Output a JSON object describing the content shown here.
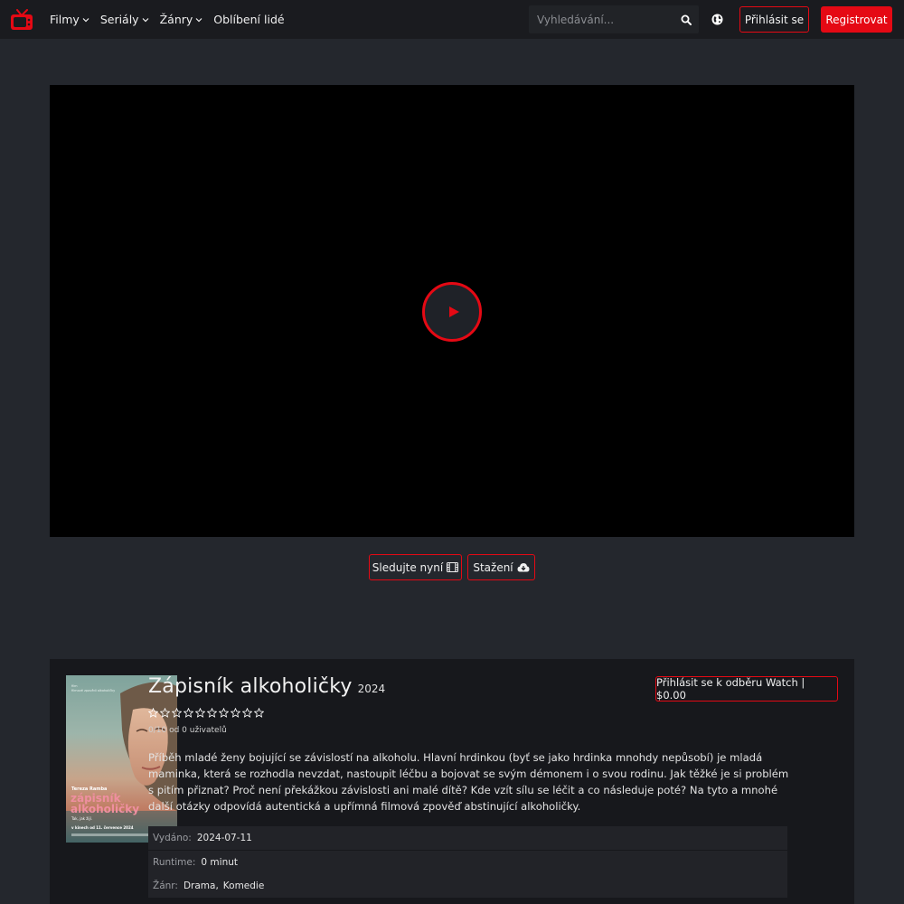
{
  "nav": {
    "menu": [
      {
        "label": "Filmy",
        "dropdown": true
      },
      {
        "label": "Seriály",
        "dropdown": true
      },
      {
        "label": "Žánry",
        "dropdown": true
      },
      {
        "label": "Oblíbení lidé",
        "dropdown": false
      }
    ],
    "search_placeholder": "Vyhledávání...",
    "login_label": "Přihlásit se",
    "register_label": "Registrovat",
    "accent_color": "#e50914"
  },
  "player": {
    "watch_label": "Sledujte nyní",
    "download_label": "Stažení"
  },
  "movie": {
    "title": "Zápisník alkoholičky",
    "year": "2024",
    "star_count": 10,
    "rating_value": 0,
    "rating_text": "0/10 od 0 uživatelů",
    "subscribe_label": "Přihlásit se k odběru Watch | $0.00",
    "description": "Příběh mladé ženy bojující se závislostí na alkoholu. Hlavní hrdinkou (byť se jako hrdinka mnohdy nepůsobí) je mladá maminka, která se rozhodla nevzdat, nastoupit léčbu a bojovat se svým démonem i o svou rodinu. Jak těžké je si problém s pitím přiznat? Proč není překážkou závislosti ani malé dítě? Kde vzít sílu se léčit a co následuje poté? Na tyto a mnohé další otázky odpovídá autentická a upřímná filmová zpověď abstinující alkoholičky.",
    "meta": {
      "released_label": "Vydáno:",
      "released_value": "2024-07-11",
      "runtime_label": "Runtime:",
      "runtime_value": "0 minut",
      "genre_label": "Žánr:",
      "genres": [
        "Drama,",
        "Komedie"
      ]
    },
    "poster": {
      "actress": "Tereza Ramba",
      "title_line1": "zápisník",
      "title_line2": "alkoholičky",
      "tagline": "Tak, jak žijí.",
      "release_line": "v kinech od 11. července 2024"
    }
  }
}
